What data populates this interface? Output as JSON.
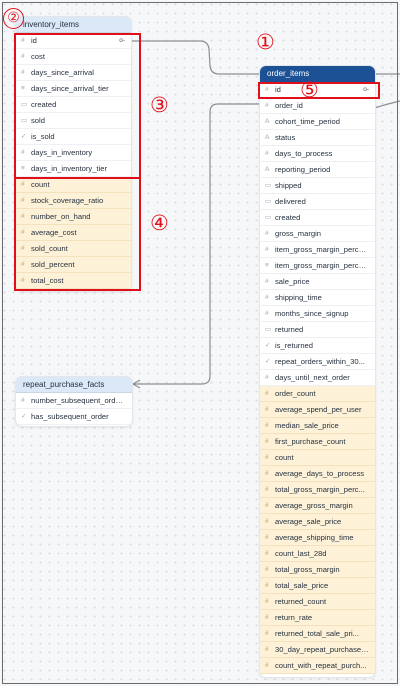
{
  "icons": {
    "dimension": "#",
    "date": "▭",
    "yesno": "✓",
    "tier": "≡",
    "text": "A",
    "key": "o‑"
  },
  "colors": {
    "highlight": "#e0101a",
    "measure_row": "#fdf1d8",
    "header_light": "#dbe8f8",
    "header_dark": "#1c5196"
  },
  "annotations": {
    "n1": "①",
    "n2": "②",
    "n3": "③",
    "n4": "④",
    "n5": "⑤"
  },
  "inventory_items": {
    "title": "inventory_items",
    "fields": [
      {
        "icon": "dimension",
        "label": "id",
        "key": true
      },
      {
        "icon": "dimension",
        "label": "cost"
      },
      {
        "icon": "dimension",
        "label": "days_since_arrival"
      },
      {
        "icon": "tier",
        "label": "days_since_arrival_tier"
      },
      {
        "icon": "date",
        "label": "created"
      },
      {
        "icon": "date",
        "label": "sold"
      },
      {
        "icon": "yesno",
        "label": "is_sold"
      },
      {
        "icon": "dimension",
        "label": "days_in_inventory"
      },
      {
        "icon": "tier",
        "label": "days_in_inventory_tier"
      }
    ],
    "measures": [
      "count",
      "stock_coverage_ratio",
      "number_on_hand",
      "average_cost",
      "sold_count",
      "sold_percent",
      "total_cost"
    ]
  },
  "repeat_purchase_facts": {
    "title": "repeat_purchase_facts",
    "fields": [
      {
        "icon": "dimension",
        "label": "number_subsequent_order..."
      },
      {
        "icon": "yesno",
        "label": "has_subsequent_order"
      }
    ]
  },
  "order_items": {
    "title": "order_items",
    "fields": [
      {
        "icon": "dimension",
        "label": "id",
        "key": true
      },
      {
        "icon": "dimension",
        "label": "order_id"
      },
      {
        "icon": "text",
        "label": "cohort_time_period"
      },
      {
        "icon": "text",
        "label": "status"
      },
      {
        "icon": "dimension",
        "label": "days_to_process"
      },
      {
        "icon": "text",
        "label": "reporting_period"
      },
      {
        "icon": "date",
        "label": "shipped"
      },
      {
        "icon": "date",
        "label": "delivered"
      },
      {
        "icon": "date",
        "label": "created"
      },
      {
        "icon": "dimension",
        "label": "gross_margin"
      },
      {
        "icon": "dimension",
        "label": "item_gross_margin_perce..."
      },
      {
        "icon": "tier",
        "label": "item_gross_margin_perce..."
      },
      {
        "icon": "dimension",
        "label": "sale_price"
      },
      {
        "icon": "dimension",
        "label": "shipping_time"
      },
      {
        "icon": "dimension",
        "label": "months_since_signup"
      },
      {
        "icon": "date",
        "label": "returned"
      },
      {
        "icon": "yesno",
        "label": "is_returned"
      },
      {
        "icon": "yesno",
        "label": "repeat_orders_within_30..."
      },
      {
        "icon": "dimension",
        "label": "days_until_next_order"
      }
    ],
    "measures": [
      "order_count",
      "average_spend_per_user",
      "median_sale_price",
      "first_purchase_count",
      "count",
      "average_days_to_process",
      "total_gross_margin_perc...",
      "average_gross_margin",
      "average_sale_price",
      "average_shipping_time",
      "count_last_28d",
      "total_gross_margin",
      "total_sale_price",
      "returned_count",
      "return_rate",
      "returned_total_sale_pri...",
      "30_day_repeat_purchase_...",
      "count_with_repeat_purch..."
    ]
  }
}
